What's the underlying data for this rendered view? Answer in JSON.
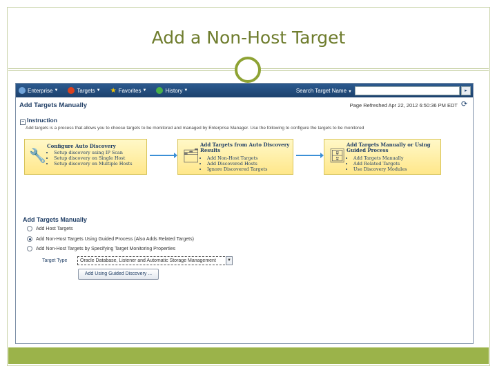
{
  "slide": {
    "title": "Add a Non-Host Target"
  },
  "nav": {
    "items": [
      {
        "label": "Enterprise",
        "icon": "enterprise-icon",
        "color": "#6fa2d8"
      },
      {
        "label": "Targets",
        "icon": "targets-icon",
        "color": "#d9411e"
      },
      {
        "label": "Favorites",
        "icon": "favorites-star-icon",
        "color": "#f5c400"
      },
      {
        "label": "History",
        "icon": "history-clock-icon",
        "color": "#48b048"
      }
    ],
    "search_label": "Search Target Name",
    "search_value": "",
    "go_glyph": "▸"
  },
  "page": {
    "title": "Add Targets Manually",
    "refreshed": "Page Refreshed Apr 22, 2012 6:50:36 PM EDT"
  },
  "instruction": {
    "heading": "Instruction",
    "text": "Add targets is a process that allows you to choose targets to be monitored and managed by Enterprise Manager. Use the following to configure the targets to be monitored",
    "cards": [
      {
        "title": "Configure Auto Discovery",
        "items": [
          "Setup discovery using IP Scan",
          "Setup discovery on Single Host",
          "Setup discovery on Multiple Hosts"
        ]
      },
      {
        "title": "Add Targets from Auto Discovery Results",
        "items": [
          "Add Non-Host Targets",
          "Add Discovered Hosts",
          "Ignore Discovered Targets"
        ]
      },
      {
        "title": "Add Targets Manually or Using Guided Process",
        "items": [
          "Add Targets Manually",
          "Add Related Targets",
          "Use Discovery Modules"
        ]
      }
    ]
  },
  "manual": {
    "heading": "Add Targets Manually",
    "options": [
      {
        "label": "Add Host Targets",
        "selected": false
      },
      {
        "label": "Add Non-Host Targets Using Guided Process (Also Adds Related Targets)",
        "selected": true
      },
      {
        "label": "Add Non-Host Targets by Specifying Target Monitoring Properties",
        "selected": false
      }
    ],
    "target_type_label": "Target Type",
    "target_type_value": "Oracle Database, Listener and Automatic Storage Management",
    "button_label": "Add Using Guided Discovery ..."
  },
  "colors": {
    "accent": "#6f7d2e",
    "nav_bar": "#1c416d",
    "card_fill": "#ffe78a",
    "footer_bar": "#9bb34a"
  }
}
